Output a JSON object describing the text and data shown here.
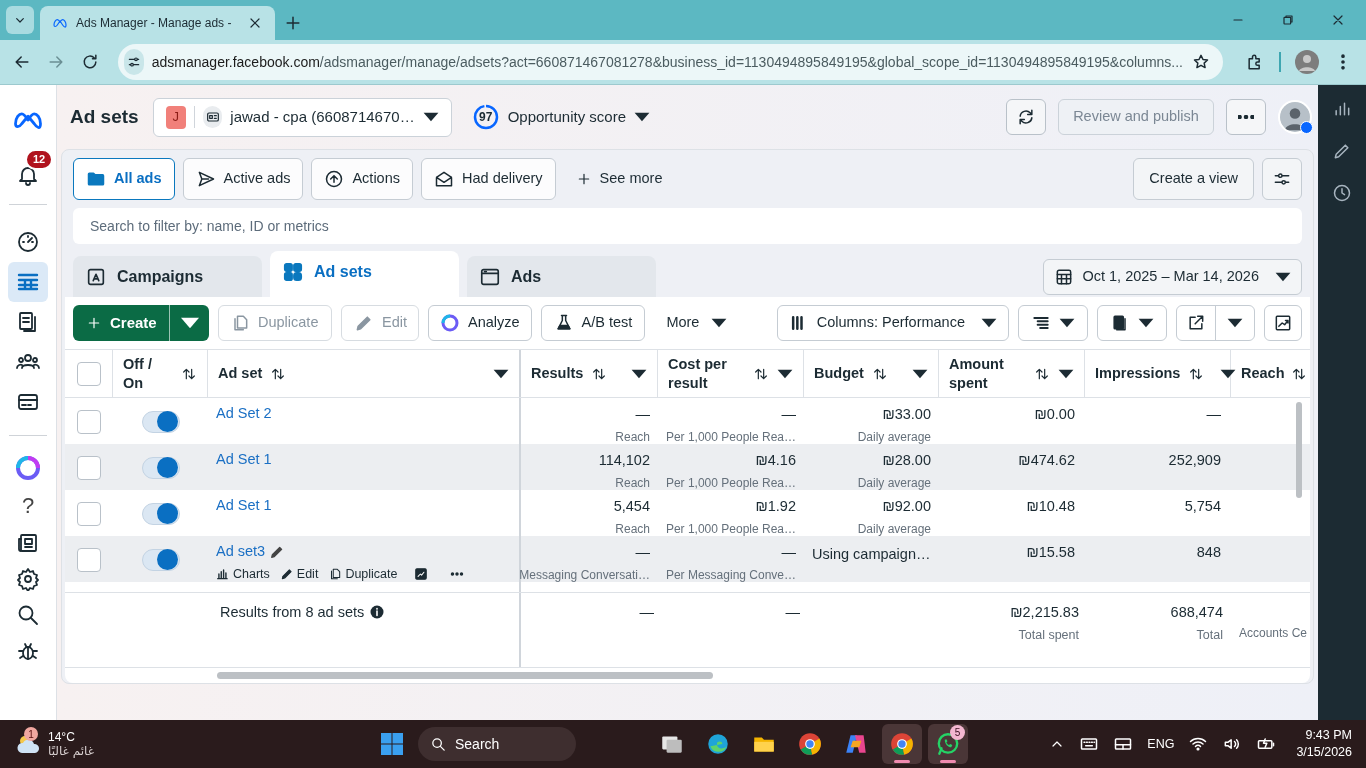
{
  "browser": {
    "tab_title": "Ads Manager - Manage ads -",
    "url_host": "adsmanager.facebook.com",
    "url_path": "/adsmanager/manage/adsets?act=660871467081278&business_id=1130494895849195&global_scope_id=1130494895849195&columns..."
  },
  "header": {
    "title": "Ad sets",
    "account_initial": "J",
    "account_name": "jawad - cpa (6608714670…",
    "score": "97",
    "level": 0.97,
    "score_label": "Opportunity score",
    "publish": "Review and publish",
    "publish_disabled": true
  },
  "sidebar": {
    "notifications": "12",
    "help": "?",
    "items": [
      {
        "kind": "gauge",
        "selected": false
      },
      {
        "kind": "table",
        "selected": true
      },
      {
        "kind": "pages",
        "selected": false
      },
      {
        "kind": "people",
        "selected": false
      },
      {
        "kind": "card",
        "selected": false
      }
    ]
  },
  "filters": [
    {
      "kind": "folder",
      "label": "All ads",
      "selected": true
    },
    {
      "kind": "send",
      "label": "Active ads",
      "selected": false
    },
    {
      "kind": "upload",
      "label": "Actions",
      "selected": false
    },
    {
      "kind": "mail",
      "label": "Had delivery",
      "selected": false
    }
  ],
  "see_more": "See more",
  "create_view": "Create a view",
  "search_placeholder": "Search to filter by: name, ID or metrics",
  "level_tabs": [
    {
      "kind": "campaigns",
      "label": "Campaigns",
      "selected": false
    },
    {
      "kind": "adsets",
      "label": "Ad sets",
      "selected": true
    },
    {
      "kind": "ads",
      "label": "Ads",
      "selected": false
    }
  ],
  "date_range": "Oct 1, 2025 – Mar 14, 2026",
  "toolbar": {
    "create": "Create",
    "duplicate": "Duplicate",
    "duplicate_disabled": true,
    "edit": "Edit",
    "edit_disabled": true,
    "analyze": "Analyze",
    "ab_test": "A/B test",
    "more": "More",
    "columns": "Columns: Performance"
  },
  "table": {
    "select_all_checked": false,
    "columns": [
      "Off / On",
      "Ad set",
      "Results",
      "Cost per result",
      "Budget",
      "Amount spent",
      "Impressions",
      "Reach"
    ],
    "rows": [
      {
        "checked": false,
        "on": true,
        "shaded": false,
        "name": "Ad Set 2",
        "results": "—",
        "results_sub": "Reach",
        "cost": "—",
        "cost_sub": "Per 1,000 People Rea…",
        "budget": "₪33.00",
        "budget_sub": "Daily average",
        "spent": "₪0.00",
        "impressions": "—"
      },
      {
        "checked": false,
        "on": true,
        "shaded": true,
        "name": "Ad Set 1",
        "results": "114,102",
        "results_sub": "Reach",
        "cost": "₪4.16",
        "cost_sub": "Per 1,000 People Rea…",
        "budget": "₪28.00",
        "budget_sub": "Daily average",
        "spent": "₪474.62",
        "impressions": "252,909"
      },
      {
        "checked": false,
        "on": true,
        "shaded": false,
        "name": "Ad Set 1",
        "results": "5,454",
        "results_sub": "Reach",
        "cost": "₪1.92",
        "cost_sub": "Per 1,000 People Rea…",
        "budget": "₪92.00",
        "budget_sub": "Daily average",
        "spent": "₪10.48",
        "impressions": "5,754"
      },
      {
        "checked": false,
        "on": true,
        "shaded": true,
        "name": "Ad set3",
        "actions": [
          {
            "kind": "charts",
            "label": "Charts"
          },
          {
            "kind": "edit",
            "label": "Edit"
          },
          {
            "kind": "duplicate",
            "label": "Duplicate"
          }
        ],
        "results": "—",
        "results_sub": "Messaging Conversati…",
        "cost": "—",
        "cost_sub": "Per Messaging Conve…",
        "budget": "Using campaign…",
        "spent": "₪15.58",
        "impressions": "848"
      }
    ],
    "footer": {
      "summary": "Results from 8 ad sets",
      "results": "—",
      "cost": "—",
      "spent": "₪2,215.83",
      "spent_sub": "Total spent",
      "impressions": "688,474",
      "impressions_sub": "Total",
      "reach_sub": "Accounts Ce"
    }
  },
  "taskbar": {
    "weather_badge": "1",
    "temp": "14°C",
    "weather": "غائم غالبًا",
    "search": "Search",
    "lang": "ENG",
    "time": "9:43 PM",
    "date": "3/15/2026",
    "apps": [
      {
        "kind": "taskview",
        "active": false
      },
      {
        "kind": "edge",
        "active": false
      },
      {
        "kind": "folder",
        "active": false
      },
      {
        "kind": "chrome",
        "active": false
      },
      {
        "kind": "copilot",
        "active": false
      },
      {
        "kind": "chrome",
        "active": true
      },
      {
        "kind": "whatsapp",
        "active": true,
        "badge": "5"
      }
    ]
  }
}
